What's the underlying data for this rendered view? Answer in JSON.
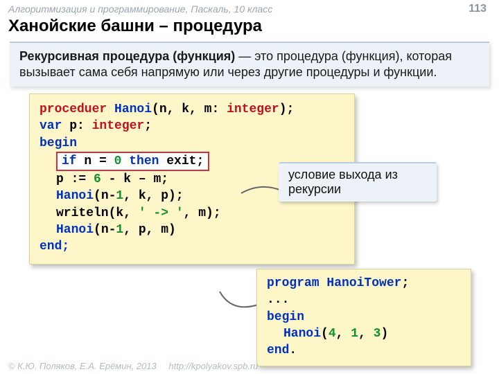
{
  "header": {
    "course": "Алгоритмизация и программирование, Паскаль, 10 класс",
    "page": "113"
  },
  "title": "Ханойские башни – процедура",
  "definition": {
    "lead": "Рекурсивная процедура (функция)",
    "body": " — это процедура (функция), которая вызывает сама себя напрямую или через другие процедуры и функции."
  },
  "code": {
    "l1_proc": "proceduer ",
    "l1_name": "Hanoi",
    "l1_sig_a": "(n, k, m: ",
    "l1_int": "integer",
    "l1_sig_b": ");",
    "l2_var": "var ",
    "l2_p": "p: ",
    "l2_int": "integer",
    "l2_semi": ";",
    "l3_begin": "begin",
    "l4_if": "if ",
    "l4_nEq": "n = ",
    "l4_zero": "0",
    "l4_then": " then ",
    "l4_exit": "exit",
    "l4_semi": ";",
    "l5_a": "p := ",
    "l5_six": "6",
    "l5_b": " - k – m;",
    "l6_name": "Hanoi",
    "l6_a": "(n-",
    "l6_one": "1",
    "l6_b": ", k, p);",
    "l7_a": "writeln(k, ",
    "l7_arr": "' -> '",
    "l7_b": ", m);",
    "l8_name": "Hanoi",
    "l8_a": "(n-",
    "l8_one": "1",
    "l8_b": ", p, m)",
    "l9_end": "end;"
  },
  "note1": "условие выхода из рекурсии",
  "program": {
    "l1_prog": "program ",
    "l1_name": "HanoiTower",
    "l1_semi": ";",
    "l2_dots": "...",
    "l3_begin": "begin",
    "l4_name": "Hanoi",
    "l4_args": "(",
    "l4_4": "4",
    "l4_c1": ", ",
    "l4_1": "1",
    "l4_c2": ", ",
    "l4_3": "3",
    "l4_close": ")",
    "l5_end": "end",
    "l5_dot": "."
  },
  "footer": {
    "copy": "© К.Ю. Поляков, Е.А. Ерёмин, 2013",
    "url": "http://kpolyakov.spb.ru"
  }
}
